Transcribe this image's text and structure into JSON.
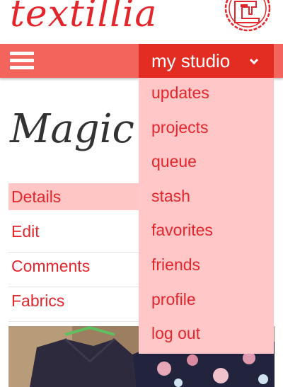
{
  "header": {
    "logo_text": "textillia",
    "badge_icon": "sewing-machine-icon"
  },
  "navbar": {
    "menu_icon": "hamburger-icon",
    "studio_label": "my studio",
    "chevron_icon": "chevron-down-icon"
  },
  "page": {
    "title": "Magic T"
  },
  "tabs": [
    "Details",
    "Edit",
    "Comments",
    "Fabrics"
  ],
  "dropdown": {
    "items": [
      "updates",
      "projects",
      "queue",
      "stash",
      "favorites",
      "friends",
      "profile",
      "log out"
    ]
  },
  "colors": {
    "brand_red": "#e2262b",
    "navbar": "#f2645c",
    "studio_button": "#e32d22",
    "dropdown_bg": "#ffc7c7",
    "active_tab_bg": "#ffc6c6"
  }
}
